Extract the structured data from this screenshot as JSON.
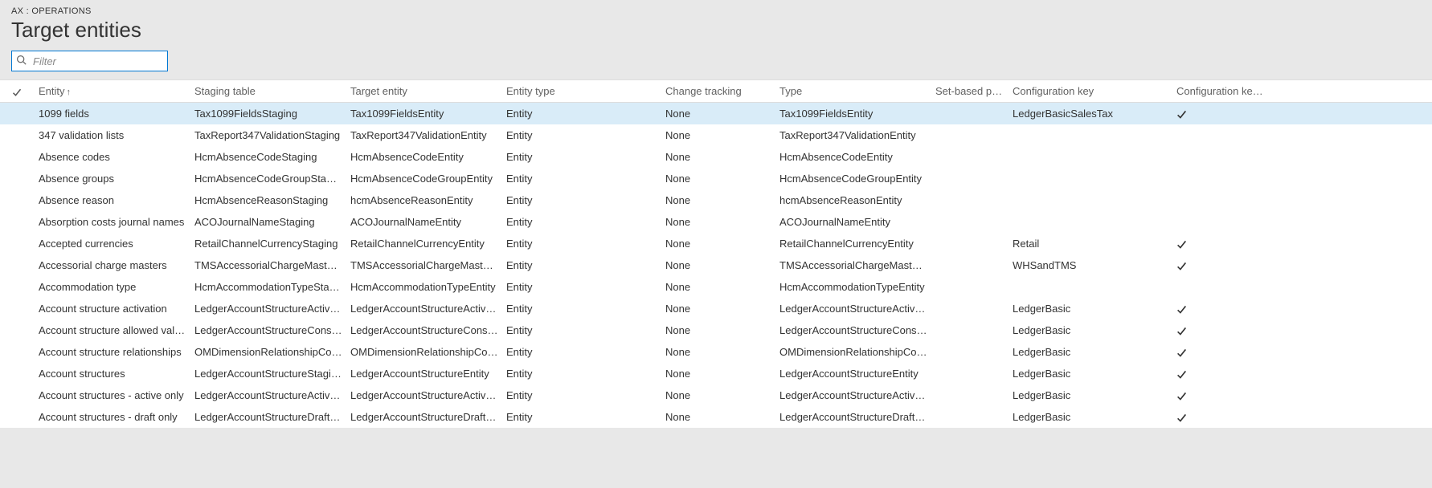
{
  "breadcrumb": "AX : OPERATIONS",
  "page_title": "Target entities",
  "filter": {
    "placeholder": "Filter"
  },
  "columns": {
    "entity": "Entity",
    "staging": "Staging table",
    "target": "Target entity",
    "etype": "Entity type",
    "change": "Change tracking",
    "type": "Type",
    "setbased": "Set-based proc...",
    "confkey": "Configuration key",
    "confstatus": "Configuration key status"
  },
  "sort_indicator": "↑",
  "rows": [
    {
      "selected": true,
      "entity": "1099 fields",
      "staging": "Tax1099FieldsStaging",
      "target": "Tax1099FieldsEntity",
      "etype": "Entity",
      "change": "None",
      "type": "Tax1099FieldsEntity",
      "confkey": "LedgerBasicSalesTax",
      "confstatus": true
    },
    {
      "selected": false,
      "entity": "347 validation lists",
      "staging": "TaxReport347ValidationStaging",
      "target": "TaxReport347ValidationEntity",
      "etype": "Entity",
      "change": "None",
      "type": "TaxReport347ValidationEntity",
      "confkey": "",
      "confstatus": false
    },
    {
      "selected": false,
      "entity": "Absence codes",
      "staging": "HcmAbsenceCodeStaging",
      "target": "HcmAbsenceCodeEntity",
      "etype": "Entity",
      "change": "None",
      "type": "HcmAbsenceCodeEntity",
      "confkey": "",
      "confstatus": false
    },
    {
      "selected": false,
      "entity": "Absence groups",
      "staging": "HcmAbsenceCodeGroupStaging",
      "target": "HcmAbsenceCodeGroupEntity",
      "etype": "Entity",
      "change": "None",
      "type": "HcmAbsenceCodeGroupEntity",
      "confkey": "",
      "confstatus": false
    },
    {
      "selected": false,
      "entity": "Absence reason",
      "staging": "HcmAbsenceReasonStaging",
      "target": "hcmAbsenceReasonEntity",
      "etype": "Entity",
      "change": "None",
      "type": "hcmAbsenceReasonEntity",
      "confkey": "",
      "confstatus": false
    },
    {
      "selected": false,
      "entity": "Absorption costs journal names",
      "staging": "ACOJournalNameStaging",
      "target": "ACOJournalNameEntity",
      "etype": "Entity",
      "change": "None",
      "type": "ACOJournalNameEntity",
      "confkey": "",
      "confstatus": false
    },
    {
      "selected": false,
      "entity": "Accepted currencies",
      "staging": "RetailChannelCurrencyStaging",
      "target": "RetailChannelCurrencyEntity",
      "etype": "Entity",
      "change": "None",
      "type": "RetailChannelCurrencyEntity",
      "confkey": "Retail",
      "confstatus": true
    },
    {
      "selected": false,
      "entity": "Accessorial charge masters",
      "staging": "TMSAccessorialChargeMasterSt...",
      "target": "TMSAccessorialChargeMasterEn...",
      "etype": "Entity",
      "change": "None",
      "type": "TMSAccessorialChargeMasterEn...",
      "confkey": "WHSandTMS",
      "confstatus": true
    },
    {
      "selected": false,
      "entity": "Accommodation type",
      "staging": "HcmAccommodationTypeStaging",
      "target": "HcmAccommodationTypeEntity",
      "etype": "Entity",
      "change": "None",
      "type": "HcmAccommodationTypeEntity",
      "confkey": "",
      "confstatus": false
    },
    {
      "selected": false,
      "entity": "Account structure activation",
      "staging": "LedgerAccountStructureActivati...",
      "target": "LedgerAccountStructureActivati...",
      "etype": "Entity",
      "change": "None",
      "type": "LedgerAccountStructureActivati...",
      "confkey": "LedgerBasic",
      "confstatus": true
    },
    {
      "selected": false,
      "entity": "Account structure allowed values",
      "staging": "LedgerAccountStructureConstra...",
      "target": "LedgerAccountStructureConstra...",
      "etype": "Entity",
      "change": "None",
      "type": "LedgerAccountStructureConstra...",
      "confkey": "LedgerBasic",
      "confstatus": true
    },
    {
      "selected": false,
      "entity": "Account structure relationships",
      "staging": "OMDimensionRelationshipCons...",
      "target": "OMDimensionRelationshipCons...",
      "etype": "Entity",
      "change": "None",
      "type": "OMDimensionRelationshipCons...",
      "confkey": "LedgerBasic",
      "confstatus": true
    },
    {
      "selected": false,
      "entity": "Account structures",
      "staging": "LedgerAccountStructureStaging",
      "target": "LedgerAccountStructureEntity",
      "etype": "Entity",
      "change": "None",
      "type": "LedgerAccountStructureEntity",
      "confkey": "LedgerBasic",
      "confstatus": true
    },
    {
      "selected": false,
      "entity": "Account structures - active only",
      "staging": "LedgerAccountStructureActive...",
      "target": "LedgerAccountStructureActive...",
      "etype": "Entity",
      "change": "None",
      "type": "LedgerAccountStructureActive...",
      "confkey": "LedgerBasic",
      "confstatus": true
    },
    {
      "selected": false,
      "entity": "Account structures - draft only",
      "staging": "LedgerAccountStructureDraftO...",
      "target": "LedgerAccountStructureDraftO...",
      "etype": "Entity",
      "change": "None",
      "type": "LedgerAccountStructureDraftO...",
      "confkey": "LedgerBasic",
      "confstatus": true
    }
  ]
}
